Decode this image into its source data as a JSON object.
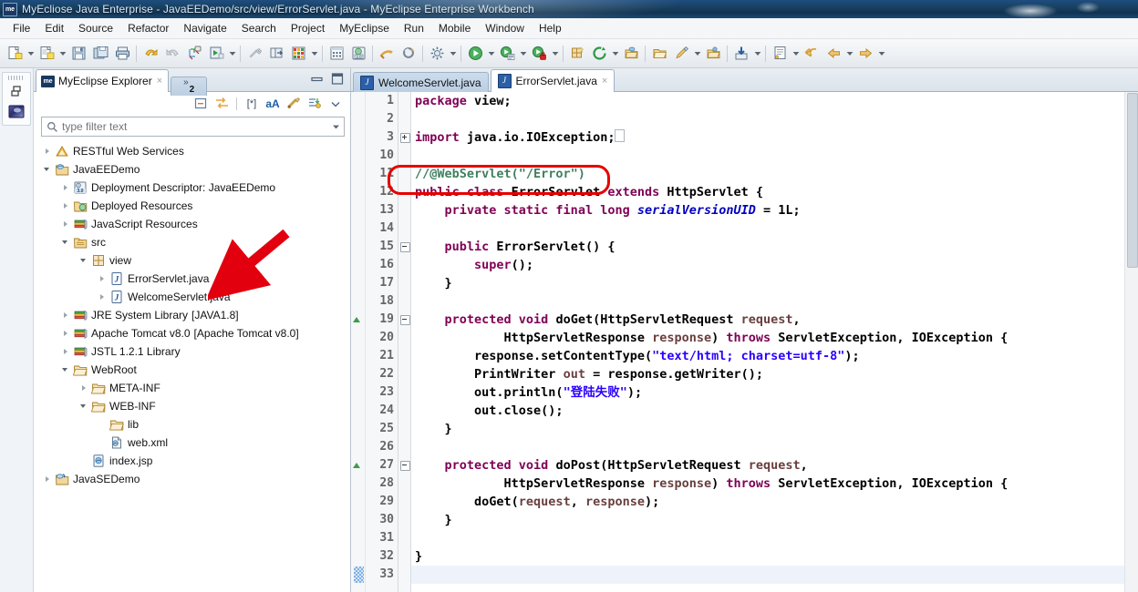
{
  "window": {
    "app_icon": "me",
    "title": "MyEcliose Java Enterprise - JavaEEDemo/src/view/ErrorServlet.java - MyEclipse Enterprise Workbench"
  },
  "menubar": {
    "items": [
      {
        "label": "File"
      },
      {
        "label": "Edit"
      },
      {
        "label": "Source"
      },
      {
        "label": "Refactor"
      },
      {
        "label": "Navigate"
      },
      {
        "label": "Search"
      },
      {
        "label": "Project"
      },
      {
        "label": "MyEclipse"
      },
      {
        "label": "Run"
      },
      {
        "label": "Mobile"
      },
      {
        "label": "Window"
      },
      {
        "label": "Help"
      }
    ]
  },
  "toolbar": {
    "buttons": [
      {
        "name": "new-wizard-icon",
        "glyph": "new-file"
      },
      {
        "name": "new-wizard-dropdown-icon",
        "glyph": "caret"
      },
      {
        "name": "new-myeclipse-project-icon",
        "glyph": "new-proj"
      },
      {
        "name": "new-myeclipse-dropdown-icon",
        "glyph": "caret"
      },
      {
        "name": "save-icon",
        "glyph": "save"
      },
      {
        "name": "save-all-icon",
        "glyph": "save-all"
      },
      {
        "name": "print-icon",
        "glyph": "print"
      },
      {
        "name": "undo-icon",
        "glyph": "undo"
      },
      {
        "name": "redo-icon",
        "glyph": "redo"
      },
      {
        "name": "debug-as-icon",
        "glyph": "debug"
      },
      {
        "name": "run-as-icon",
        "glyph": "run-green"
      },
      {
        "name": "run-as-dropdown-icon",
        "glyph": "caret"
      },
      {
        "name": "external-tools-icon",
        "glyph": "wrench"
      },
      {
        "name": "open-perspective-icon",
        "glyph": "open-persp"
      },
      {
        "name": "database-explorer-icon",
        "glyph": "db-grid"
      },
      {
        "name": "database-dropdown-icon",
        "glyph": "caret"
      },
      {
        "name": "matrix-icon",
        "glyph": "matrix"
      },
      {
        "name": "server-icon",
        "glyph": "server20"
      },
      {
        "name": "deploy-icon",
        "glyph": "deploy"
      },
      {
        "name": "refresh-deploy-icon",
        "glyph": "refresh-deploy"
      },
      {
        "name": "configure-icon",
        "glyph": "gear"
      },
      {
        "name": "configure-dropdown-icon",
        "glyph": "caret"
      },
      {
        "name": "run-icon",
        "glyph": "run-circle"
      },
      {
        "name": "run-dropdown-icon",
        "glyph": "caret"
      },
      {
        "name": "debug-config-icon",
        "glyph": "debug-cfg"
      },
      {
        "name": "debug-config-dropdown-icon",
        "glyph": "caret"
      },
      {
        "name": "run-secure-icon",
        "glyph": "run-lock"
      },
      {
        "name": "run-secure-dropdown-icon",
        "glyph": "caret"
      },
      {
        "name": "new-package-icon",
        "glyph": "new-pkg"
      },
      {
        "name": "refresh-icon",
        "glyph": "refresh-green"
      },
      {
        "name": "refresh-dropdown-icon",
        "glyph": "caret"
      },
      {
        "name": "open-type-icon",
        "glyph": "open-type"
      },
      {
        "name": "open-task-icon",
        "glyph": "open-folder"
      },
      {
        "name": "edit-icon",
        "glyph": "pencil"
      },
      {
        "name": "edit-dropdown-icon",
        "glyph": "caret"
      },
      {
        "name": "open-resource-icon",
        "glyph": "open-res"
      },
      {
        "name": "import-icon",
        "glyph": "import"
      },
      {
        "name": "import-dropdown-icon",
        "glyph": "caret"
      },
      {
        "name": "annotation-icon",
        "glyph": "annot"
      },
      {
        "name": "annotation-dropdown-icon",
        "glyph": "caret"
      },
      {
        "name": "back-icon",
        "glyph": "back-yellow"
      },
      {
        "name": "previous-icon",
        "glyph": "prev-yellow"
      },
      {
        "name": "previous-dropdown-icon",
        "glyph": "caret"
      },
      {
        "name": "forward-icon",
        "glyph": "forward-yellow"
      },
      {
        "name": "forward-dropdown-icon",
        "glyph": "caret"
      }
    ]
  },
  "fastview": {
    "items": [
      {
        "name": "restore-view-icon"
      },
      {
        "name": "myeclipse-perspective-icon"
      }
    ]
  },
  "explorer": {
    "tab": {
      "icon": "me",
      "label": "MyEclipse Explorer",
      "close": "×"
    },
    "overflow_tab": {
      "chevron": "»",
      "count": "2"
    },
    "window_buttons": [
      {
        "name": "minimize-view-button"
      },
      {
        "name": "maximize-view-button"
      }
    ],
    "local_toolbar": [
      {
        "name": "collapse-all-icon"
      },
      {
        "name": "link-with-editor-icon"
      },
      {
        "name": "select-working-set-icon",
        "label": "[*]"
      },
      {
        "name": "show-aA-icon",
        "label": "aA"
      },
      {
        "name": "filters-icon"
      },
      {
        "name": "sort-icon"
      },
      {
        "name": "view-menu-icon"
      }
    ],
    "filter": {
      "placeholder": "type filter text",
      "value": ""
    },
    "tree": [
      {
        "label": "RESTful Web Services",
        "indent": 0,
        "twisty": "collapsed",
        "icon": "rest-icon",
        "suffix": ""
      },
      {
        "label": "JavaEEDemo",
        "indent": 0,
        "twisty": "expanded",
        "icon": "jee-project-icon",
        "suffix": ""
      },
      {
        "label": "Deployment Descriptor: JavaEEDemo",
        "indent": 1,
        "twisty": "collapsed",
        "icon": "deployment-descriptor-icon",
        "suffix": ""
      },
      {
        "label": "Deployed Resources",
        "indent": 1,
        "twisty": "collapsed",
        "icon": "deployed-resources-icon",
        "suffix": ""
      },
      {
        "label": "JavaScript Resources",
        "indent": 1,
        "twisty": "collapsed",
        "icon": "library-icon",
        "suffix": ""
      },
      {
        "label": "src",
        "indent": 1,
        "twisty": "expanded",
        "icon": "source-folder-icon",
        "suffix": ""
      },
      {
        "label": "view",
        "indent": 2,
        "twisty": "expanded",
        "icon": "package-icon",
        "suffix": ""
      },
      {
        "label": "ErrorServlet.java",
        "indent": 3,
        "twisty": "collapsed",
        "icon": "java-file-icon",
        "suffix": ""
      },
      {
        "label": "WelcomeServlet.java",
        "indent": 3,
        "twisty": "collapsed",
        "icon": "java-file-icon",
        "suffix": ""
      },
      {
        "label": "JRE System Library",
        "indent": 1,
        "twisty": "collapsed",
        "icon": "library-icon",
        "suffix": "[JAVA1.8]"
      },
      {
        "label": "Apache Tomcat v8.0",
        "indent": 1,
        "twisty": "collapsed",
        "icon": "library-icon",
        "suffix": "[Apache Tomcat v8.0]"
      },
      {
        "label": "JSTL 1.2.1 Library",
        "indent": 1,
        "twisty": "collapsed",
        "icon": "library-icon",
        "suffix": ""
      },
      {
        "label": "WebRoot",
        "indent": 1,
        "twisty": "expanded",
        "icon": "folder-icon",
        "suffix": ""
      },
      {
        "label": "META-INF",
        "indent": 2,
        "twisty": "collapsed",
        "icon": "folder-icon",
        "suffix": ""
      },
      {
        "label": "WEB-INF",
        "indent": 2,
        "twisty": "expanded",
        "icon": "folder-icon",
        "suffix": ""
      },
      {
        "label": "lib",
        "indent": 3,
        "twisty": "none",
        "icon": "folder-icon",
        "suffix": ""
      },
      {
        "label": "web.xml",
        "indent": 3,
        "twisty": "none",
        "icon": "xml-file-icon",
        "suffix": ""
      },
      {
        "label": "index.jsp",
        "indent": 2,
        "twisty": "none",
        "icon": "jsp-file-icon",
        "suffix": ""
      },
      {
        "label": "JavaSEDemo",
        "indent": 0,
        "twisty": "collapsed",
        "icon": "java-project-icon",
        "suffix": ""
      }
    ]
  },
  "editor": {
    "tabs": [
      {
        "label": "WelcomeServlet.java",
        "icon": "java-file-icon",
        "active": false,
        "close": ""
      },
      {
        "label": "ErrorServlet.java",
        "icon": "java-file-icon",
        "active": true,
        "close": "×"
      }
    ],
    "lines": [
      {
        "num": "1",
        "fold": "",
        "overr": false,
        "tokens": [
          {
            "t": "package ",
            "c": "kw"
          },
          {
            "t": "view;",
            "c": "pl"
          }
        ]
      },
      {
        "num": "2",
        "fold": "",
        "overr": false,
        "tokens": []
      },
      {
        "num": "3",
        "fold": "plus",
        "overr": false,
        "tokens": [
          {
            "t": "import ",
            "c": "kw"
          },
          {
            "t": "java.io.IOException;",
            "c": "pl"
          },
          {
            "t": "⎕",
            "c": "box"
          }
        ]
      },
      {
        "num": "10",
        "fold": "",
        "overr": false,
        "tokens": []
      },
      {
        "num": "11",
        "fold": "",
        "overr": false,
        "tokens": [
          {
            "t": "//@WebServlet(\"/Error\")",
            "c": "cmt"
          }
        ]
      },
      {
        "num": "12",
        "fold": "",
        "overr": false,
        "tokens": [
          {
            "t": "public class ",
            "c": "kw"
          },
          {
            "t": "ErrorServlet ",
            "c": "pl"
          },
          {
            "t": "extends ",
            "c": "kw"
          },
          {
            "t": "HttpServlet {",
            "c": "pl"
          }
        ]
      },
      {
        "num": "13",
        "fold": "",
        "overr": false,
        "tokens": [
          {
            "t": "    ",
            "c": "pl"
          },
          {
            "t": "private static final long ",
            "c": "kw"
          },
          {
            "t": "serialVersionUID",
            "c": "fld"
          },
          {
            "t": " = 1L;",
            "c": "pl"
          }
        ]
      },
      {
        "num": "14",
        "fold": "",
        "overr": false,
        "tokens": []
      },
      {
        "num": "15",
        "fold": "minus",
        "overr": false,
        "tokens": [
          {
            "t": "    ",
            "c": "pl"
          },
          {
            "t": "public ",
            "c": "kw"
          },
          {
            "t": "ErrorServlet() {",
            "c": "pl"
          }
        ]
      },
      {
        "num": "16",
        "fold": "",
        "overr": false,
        "tokens": [
          {
            "t": "        ",
            "c": "pl"
          },
          {
            "t": "super",
            "c": "kw"
          },
          {
            "t": "();",
            "c": "pl"
          }
        ]
      },
      {
        "num": "17",
        "fold": "",
        "overr": false,
        "tokens": [
          {
            "t": "    }",
            "c": "pl"
          }
        ]
      },
      {
        "num": "18",
        "fold": "",
        "overr": false,
        "tokens": []
      },
      {
        "num": "19",
        "fold": "minus",
        "overr": true,
        "tokens": [
          {
            "t": "    ",
            "c": "pl"
          },
          {
            "t": "protected void ",
            "c": "kw"
          },
          {
            "t": "doGet(HttpServletRequest ",
            "c": "pl"
          },
          {
            "t": "request",
            "c": "par"
          },
          {
            "t": ",",
            "c": "pl"
          }
        ]
      },
      {
        "num": "20",
        "fold": "",
        "overr": false,
        "tokens": [
          {
            "t": "            HttpServletResponse ",
            "c": "pl"
          },
          {
            "t": "response",
            "c": "par"
          },
          {
            "t": ") ",
            "c": "pl"
          },
          {
            "t": "throws ",
            "c": "kw"
          },
          {
            "t": "ServletException, IOException {",
            "c": "pl"
          }
        ]
      },
      {
        "num": "21",
        "fold": "",
        "overr": false,
        "tokens": [
          {
            "t": "        response.setContentType(",
            "c": "pl"
          },
          {
            "t": "\"text/html; charset=utf-8\"",
            "c": "str"
          },
          {
            "t": ");",
            "c": "pl"
          }
        ]
      },
      {
        "num": "22",
        "fold": "",
        "overr": false,
        "tokens": [
          {
            "t": "        PrintWriter ",
            "c": "pl"
          },
          {
            "t": "out",
            "c": "par"
          },
          {
            "t": " = response.getWriter();",
            "c": "pl"
          }
        ]
      },
      {
        "num": "23",
        "fold": "",
        "overr": false,
        "tokens": [
          {
            "t": "        out.println(",
            "c": "pl"
          },
          {
            "t": "\"登陆失败\"",
            "c": "str"
          },
          {
            "t": ");",
            "c": "pl"
          }
        ]
      },
      {
        "num": "24",
        "fold": "",
        "overr": false,
        "tokens": [
          {
            "t": "        out.close();",
            "c": "pl"
          }
        ]
      },
      {
        "num": "25",
        "fold": "",
        "overr": false,
        "tokens": [
          {
            "t": "    }",
            "c": "pl"
          }
        ]
      },
      {
        "num": "26",
        "fold": "",
        "overr": false,
        "tokens": []
      },
      {
        "num": "27",
        "fold": "minus",
        "overr": true,
        "tokens": [
          {
            "t": "    ",
            "c": "pl"
          },
          {
            "t": "protected void ",
            "c": "kw"
          },
          {
            "t": "doPost(HttpServletRequest ",
            "c": "pl"
          },
          {
            "t": "request",
            "c": "par"
          },
          {
            "t": ",",
            "c": "pl"
          }
        ]
      },
      {
        "num": "28",
        "fold": "",
        "overr": false,
        "tokens": [
          {
            "t": "            HttpServletResponse ",
            "c": "pl"
          },
          {
            "t": "response",
            "c": "par"
          },
          {
            "t": ") ",
            "c": "pl"
          },
          {
            "t": "throws ",
            "c": "kw"
          },
          {
            "t": "ServletException, IOException {",
            "c": "pl"
          }
        ]
      },
      {
        "num": "29",
        "fold": "",
        "overr": false,
        "tokens": [
          {
            "t": "        doGet(",
            "c": "pl"
          },
          {
            "t": "request",
            "c": "par"
          },
          {
            "t": ", ",
            "c": "pl"
          },
          {
            "t": "response",
            "c": "par"
          },
          {
            "t": ");",
            "c": "pl"
          }
        ]
      },
      {
        "num": "30",
        "fold": "",
        "overr": false,
        "tokens": [
          {
            "t": "    }",
            "c": "pl"
          }
        ]
      },
      {
        "num": "31",
        "fold": "",
        "overr": false,
        "tokens": []
      },
      {
        "num": "32",
        "fold": "",
        "overr": false,
        "tokens": [
          {
            "t": "}",
            "c": "pl"
          }
        ]
      },
      {
        "num": "33",
        "fold": "",
        "overr": false,
        "current": true,
        "tokens": []
      }
    ]
  },
  "annotations": {
    "oval": {
      "color": "#e60000",
      "target_line": "11",
      "label": "red-oval-highlight"
    },
    "arrow": {
      "color": "#e2000f",
      "label": "red-arrow-pointing-to-ErrorServlet.java"
    }
  }
}
